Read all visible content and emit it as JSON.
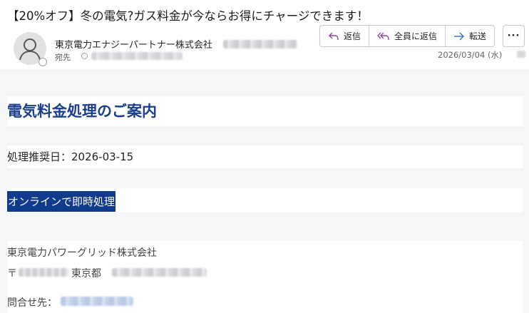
{
  "header": {
    "subject": "【20%オフ】冬の電気?ガス料金が今ならお得にチャージできます！",
    "sender_name": "東京電力エナジーパートナー株式会社",
    "to_label": "宛先",
    "date": "2026/03/04 (水)"
  },
  "actions": {
    "reply": "返信",
    "reply_all": "全員に返信",
    "forward": "転送",
    "more": "···"
  },
  "icons": {
    "avatar": "person-icon",
    "reply": "reply-arrow-icon",
    "reply_all": "reply-all-arrow-icon",
    "forward": "forward-arrow-icon",
    "more": "ellipsis-icon",
    "presence": "status-circle-icon"
  },
  "message": {
    "title": "電気料金処理のご案内",
    "due_date": "処理推奨日：2026-03-15",
    "cta": "オンラインで即時処理",
    "company": "東京電力パワーグリッド株式会社",
    "postal_mark": "〒",
    "prefecture": "東京都",
    "contact_label": "問合せ先："
  },
  "colors": {
    "title": "#1a3f8f",
    "cta_background": "#103a8c",
    "reply_icon": "#8a4a9c",
    "forward_icon": "#2f6fc7"
  }
}
